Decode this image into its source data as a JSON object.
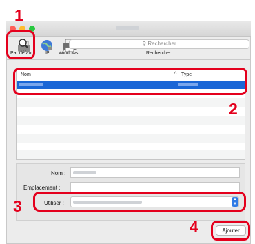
{
  "toolbar": {
    "default_label": "Par défaut",
    "ip_label": "IP",
    "windows_label": "Windows",
    "search_placeholder": "Rechercher",
    "search_caption": "Rechercher"
  },
  "table": {
    "col_name": "Nom",
    "col_type": "Type",
    "sort_indicator": "^"
  },
  "form": {
    "name_label": "Nom :",
    "location_label": "Emplacement :",
    "use_label": "Utiliser :"
  },
  "buttons": {
    "add_label": "Ajouter"
  },
  "callouts": [
    "1",
    "2",
    "3",
    "4"
  ],
  "colors": {
    "callout_red": "#e4001d",
    "selection_blue": "#1a66d6",
    "traffic_red": "#fe5f57",
    "traffic_yellow": "#febc2e",
    "traffic_green": "#28c840"
  }
}
